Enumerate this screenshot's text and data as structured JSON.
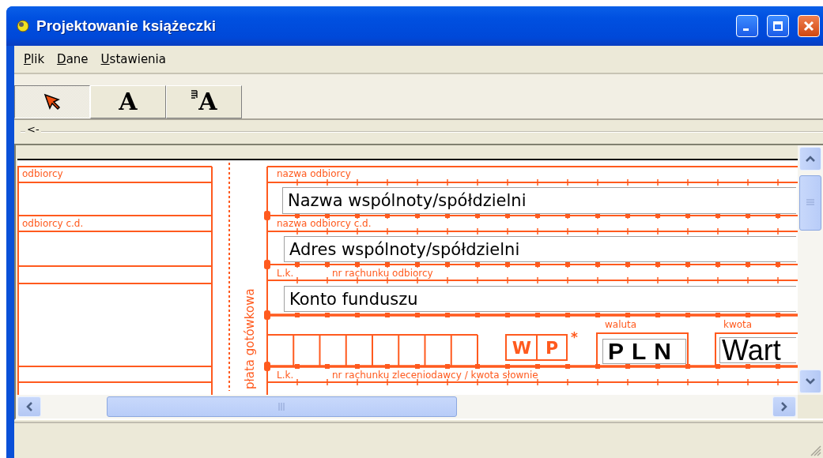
{
  "window": {
    "title": "Projektowanie książeczki"
  },
  "menu": [
    {
      "label": "Plik"
    },
    {
      "label": "Dane"
    },
    {
      "label": "Ustawienia"
    }
  ],
  "tools": [
    {
      "kind": "pointer",
      "selected": true
    },
    {
      "kind": "text",
      "label": "A",
      "selected": false
    },
    {
      "kind": "paragraph",
      "label": "A",
      "selected": false
    }
  ],
  "panel": {
    "caption": "<-"
  },
  "form": {
    "stub_labels": [
      "odbiorcy",
      "odbiorcy c.d."
    ],
    "side_text": "płata gotówkowa",
    "recipient_label": "nazwa odbiorcy",
    "recipient_value": "Nazwa wspólnoty/spółdzielni",
    "recipient2_label": "nazwa odbiorcy c.d.",
    "recipient2_value": "Adres wspólnoty/spółdzielni",
    "check_label": "L.k.",
    "account_label": "nr rachunku odbiorcy",
    "account_value": "Konto funduszu",
    "type_boxes": [
      "W",
      "P"
    ],
    "asterisk": "*",
    "currency_label": "waluta",
    "currency_value": "PLN",
    "amount_label": "kwota",
    "amount_value": "Wart",
    "check_label_2": "L.k.",
    "payer_label": "nr rachunku zleceniodawcy / kwota słownie"
  }
}
